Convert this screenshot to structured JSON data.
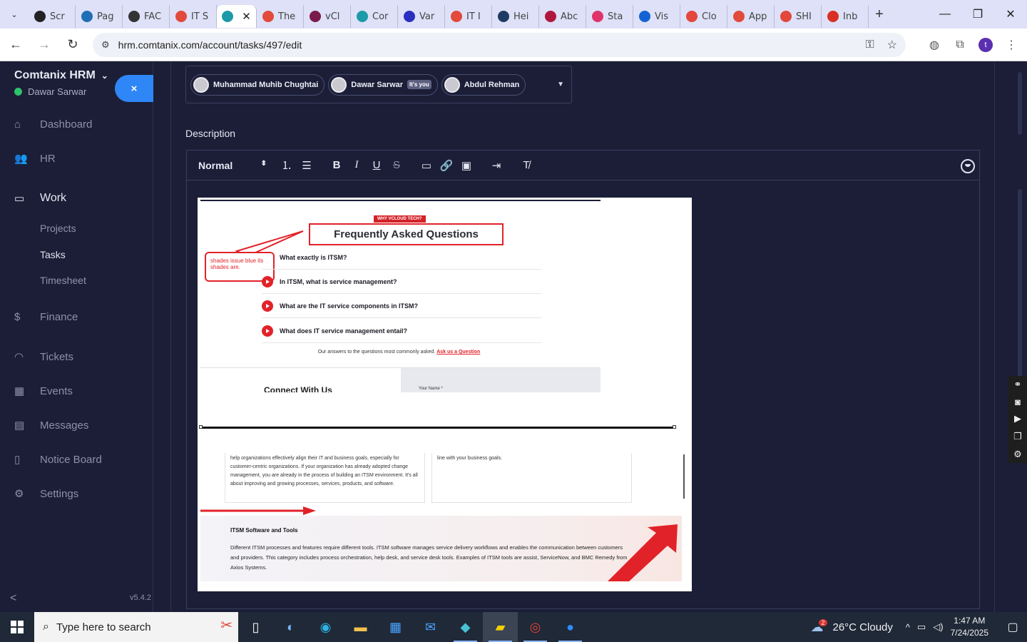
{
  "browser": {
    "tabs": [
      {
        "label": "Scr",
        "color": "#222222"
      },
      {
        "label": "Pag",
        "color": "#1f6fb5"
      },
      {
        "label": "FAC",
        "color": "#333333"
      },
      {
        "label": "IT S",
        "color": "#e24a3b"
      },
      {
        "label": "",
        "color": "#1d9aa8",
        "active": true
      },
      {
        "label": "The",
        "color": "#e24a3b"
      },
      {
        "label": "vCl",
        "color": "#7a1b4c"
      },
      {
        "label": "Cor",
        "color": "#1d9aa8"
      },
      {
        "label": "Var",
        "color": "#2a2fbf"
      },
      {
        "label": "IT I",
        "color": "#e24a3b"
      },
      {
        "label": "Hei",
        "color": "#1f3b63"
      },
      {
        "label": "Abc",
        "color": "#b0173c"
      },
      {
        "label": "Sta",
        "color": "#e0336b"
      },
      {
        "label": "Vis",
        "color": "#1463d4"
      },
      {
        "label": "Clo",
        "color": "#e2483b"
      },
      {
        "label": "App",
        "color": "#e24a3b"
      },
      {
        "label": "SHI",
        "color": "#e2483b"
      },
      {
        "label": "Inb",
        "color": "#d93025"
      }
    ],
    "url": "hrm.comtanix.com/account/tasks/497/edit",
    "profile_initial": "t"
  },
  "sidebar": {
    "brand": "Comtanix HRM",
    "user": "Dawar Sarwar",
    "close_label": "×",
    "items": [
      {
        "label": "Dashboard",
        "icon": "⌂"
      },
      {
        "label": "HR",
        "icon": "👥"
      },
      {
        "label": "Work",
        "icon": "▭"
      },
      {
        "label": "Finance",
        "icon": "$"
      },
      {
        "label": "Tickets",
        "icon": "◠"
      },
      {
        "label": "Events",
        "icon": "▦"
      },
      {
        "label": "Messages",
        "icon": "▤"
      },
      {
        "label": "Notice Board",
        "icon": "▯"
      },
      {
        "label": "Settings",
        "icon": "⚙"
      }
    ],
    "work_sub": [
      "Projects",
      "Tasks",
      "Timesheet"
    ],
    "version": "v5.4.2"
  },
  "task_form": {
    "assignees": [
      {
        "name": "Muhammad Muhib Chughtai"
      },
      {
        "name": "Dawar Sarwar",
        "badge": "It's you"
      },
      {
        "name": "Abdul Rehman"
      }
    ],
    "description_label": "Description",
    "editor": {
      "heading_select": "Normal"
    }
  },
  "embedded_image": {
    "why_badge": "WHY VCLOUD TECH?",
    "faq_title": "Frequently Asked Questions",
    "callout": "shades issue blue its shades are.",
    "questions": [
      "What exactly is ITSM?",
      "In ITSM, what is service management?",
      "What are the IT service components in ITSM?",
      "What does IT service management entail?"
    ],
    "answers_text": "Our answers to the questions most commonly asked.",
    "ask_link": "Ask us a Question",
    "connect_title": "Connect With Us",
    "name_label": "Your Name *",
    "card_left": "help organizations effectively align their IT and business goals, especially for customer-centric organizations. If your organization has already adopted change management, you are already in the process of building an ITSM environment. It's all about improving and growing processes, services, products, and software.",
    "card_right": "line with your business goals.",
    "tools_title": "ITSM Software and Tools",
    "tools_body": "Different ITSM processes and features require different tools. ITSM software manages service delivery workflows and enables the communication between customers and providers. This category includes process orchestration, help desk, and service desk tools. Examples of ITSM tools are assist, ServiceNow, and BMC Remedy from Axios Systems."
  },
  "taskbar": {
    "search_placeholder": "Type here to search",
    "weather": "26°C  Cloudy",
    "weather_alerts": "2",
    "time": "1:47 AM",
    "date": "7/24/2025"
  }
}
